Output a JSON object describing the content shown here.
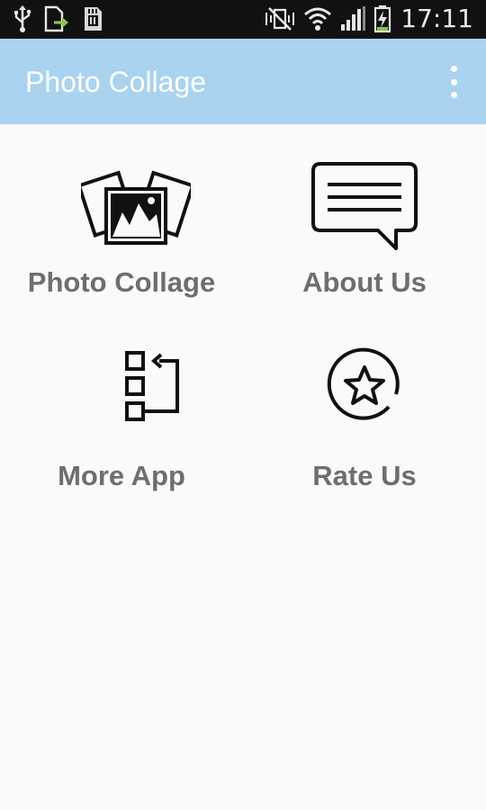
{
  "status_bar": {
    "time": "17:11",
    "icons": [
      "usb-icon",
      "file-upload-icon",
      "sd-card-icon",
      "mute-icon",
      "wifi-icon",
      "signal-icon",
      "battery-charging-icon"
    ]
  },
  "app_bar": {
    "title": "Photo Collage",
    "menu_icon": "overflow-menu-icon"
  },
  "menu": {
    "items": [
      {
        "label": "Photo Collage",
        "icon": "photo-collage-icon"
      },
      {
        "label": "About Us",
        "icon": "chat-bubble-icon"
      },
      {
        "label": "More App",
        "icon": "more-apps-icon"
      },
      {
        "label": "Rate Us",
        "icon": "star-circle-icon"
      }
    ]
  },
  "colors": {
    "app_bar": "#a9d3ee",
    "status_bar": "#111111",
    "background": "#fafafa",
    "label": "#6e6e6e",
    "battery_charge": "#8bc34a"
  }
}
